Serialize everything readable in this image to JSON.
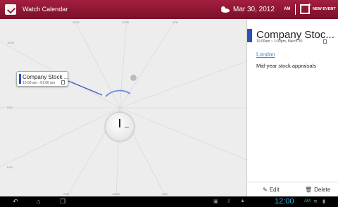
{
  "topbar": {
    "app_title": "Watch Calendar",
    "date": "Mar 30, 2012",
    "ampm": "AM",
    "new_event_label": "NEW EVENT"
  },
  "clock": {
    "hour_labels": [
      {
        "text": "11:00"
      },
      {
        "text": "12:00"
      },
      {
        "text": "1:00"
      },
      {
        "text": "10:00"
      },
      {
        "text": "9:00"
      },
      {
        "text": "8:00"
      },
      {
        "text": "7:00"
      },
      {
        "text": "06:00"
      },
      {
        "text": "5:00"
      }
    ],
    "center_tag": "9:00"
  },
  "event_card": {
    "title": "Company Stock ...",
    "time": "10:00 am - 01:00 pm"
  },
  "detail": {
    "title": "Company Stoc...",
    "time": "10:00am ~ 1:00pm, March 30",
    "location": "London",
    "description": "Mid-year stock appraisals",
    "edit_label": "Edit",
    "delete_label": "Delete"
  },
  "sysbar": {
    "time": "12:00",
    "status": "AM"
  },
  "colors": {
    "accent": "#a31f3e",
    "event_bar": "#2c4fb8",
    "link": "#3a86c8",
    "system_clock": "#3ab0e0"
  }
}
